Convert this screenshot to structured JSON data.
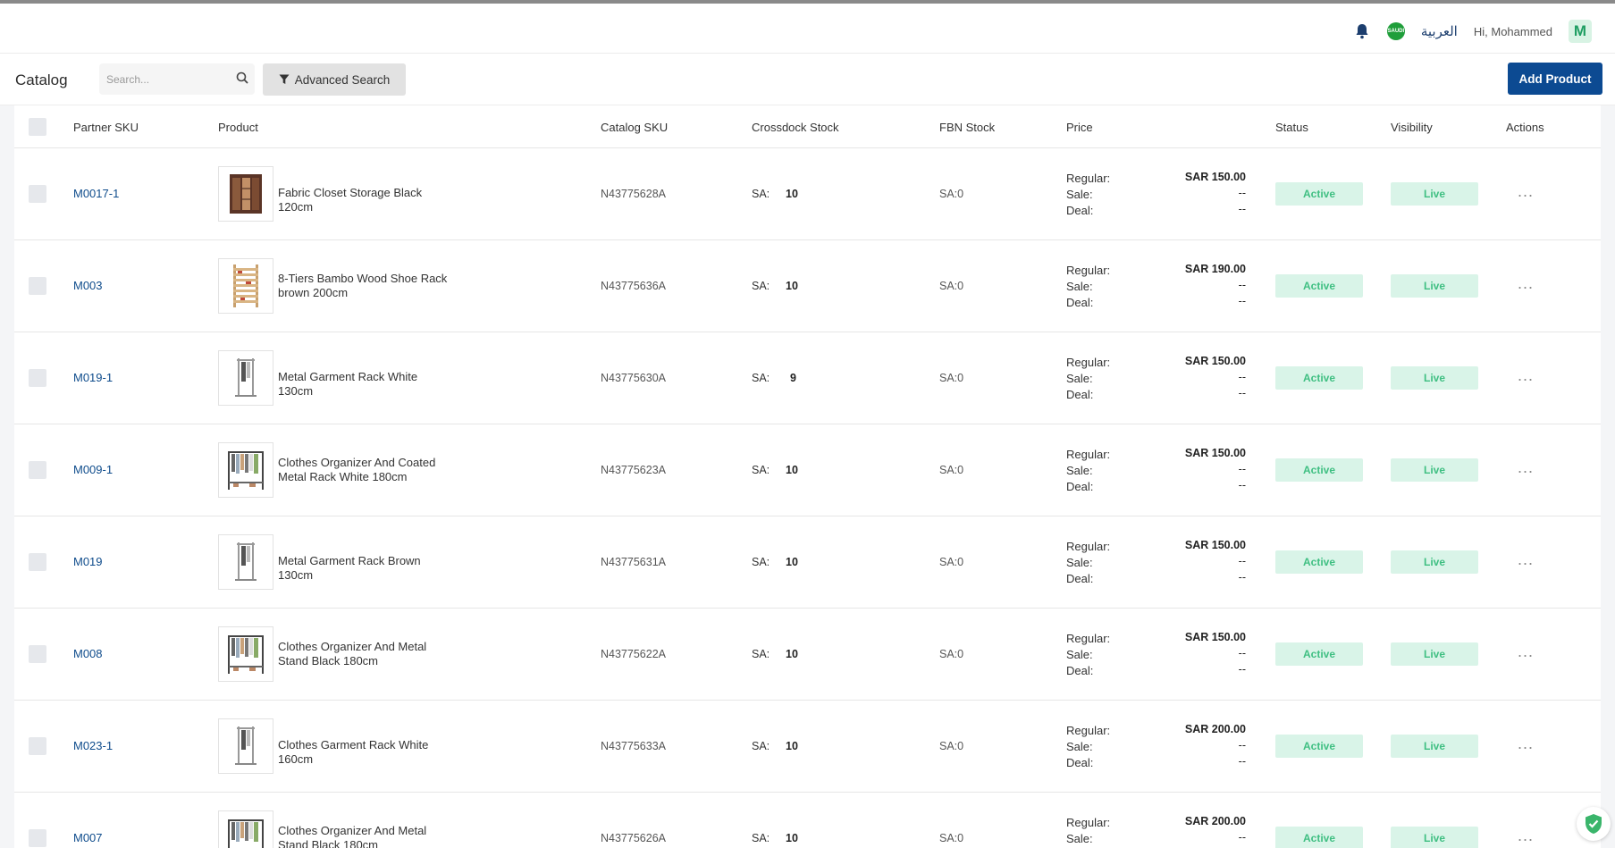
{
  "header": {
    "language": "العربية",
    "greeting": "Hi, Mohammed",
    "avatar_initial": "M",
    "flag_text": "SAUDI"
  },
  "toolbar": {
    "title": "Catalog",
    "search_placeholder": "Search...",
    "advanced_search": "Advanced Search",
    "add_product": "Add Product"
  },
  "columns": {
    "partner_sku": "Partner SKU",
    "product": "Product",
    "catalog_sku": "Catalog SKU",
    "crossdock": "Crossdock Stock",
    "fbn": "FBN Stock",
    "price": "Price",
    "status": "Status",
    "visibility": "Visibility",
    "actions": "Actions"
  },
  "labels": {
    "regular": "Regular:",
    "sale": "Sale:",
    "deal": "Deal:",
    "sa": "SA:",
    "dash": "--",
    "more": "..."
  },
  "rows": [
    {
      "sku": "M0017-1",
      "name": "Fabric Closet Storage Black 120cm",
      "catalog_sku": "N43775628A",
      "crossdock": "10",
      "fbn": "SA:0",
      "regular": "SAR 150.00",
      "status": "Active",
      "visibility": "Live",
      "thumb": "closet"
    },
    {
      "sku": "M003",
      "name": "8-Tiers Bambo Wood Shoe Rack brown 200cm",
      "catalog_sku": "N43775636A",
      "crossdock": "10",
      "fbn": "SA:0",
      "regular": "SAR 190.00",
      "status": "Active",
      "visibility": "Live",
      "thumb": "shelf"
    },
    {
      "sku": "M019-1",
      "name": "Metal Garment Rack White 130cm",
      "catalog_sku": "N43775630A",
      "crossdock": "9",
      "fbn": "SA:0",
      "regular": "SAR 150.00",
      "status": "Active",
      "visibility": "Live",
      "thumb": "rack"
    },
    {
      "sku": "M009-1",
      "name": "Clothes Organizer And Coated Metal Rack White 180cm",
      "catalog_sku": "N43775623A",
      "crossdock": "10",
      "fbn": "SA:0",
      "regular": "SAR 150.00",
      "status": "Active",
      "visibility": "Live",
      "thumb": "wide"
    },
    {
      "sku": "M019",
      "name": "Metal Garment Rack Brown 130cm",
      "catalog_sku": "N43775631A",
      "crossdock": "10",
      "fbn": "SA:0",
      "regular": "SAR 150.00",
      "status": "Active",
      "visibility": "Live",
      "thumb": "rack"
    },
    {
      "sku": "M008",
      "name": "Clothes Organizer And Metal Stand Black 180cm",
      "catalog_sku": "N43775622A",
      "crossdock": "10",
      "fbn": "SA:0",
      "regular": "SAR 150.00",
      "status": "Active",
      "visibility": "Live",
      "thumb": "wide"
    },
    {
      "sku": "M023-1",
      "name": "Clothes Garment Rack White 160cm",
      "catalog_sku": "N43775633A",
      "crossdock": "10",
      "fbn": "SA:0",
      "regular": "SAR 200.00",
      "status": "Active",
      "visibility": "Live",
      "thumb": "rack"
    },
    {
      "sku": "M007",
      "name": "Clothes Organizer And Metal Stand Black 180cm",
      "catalog_sku": "N43775626A",
      "crossdock": "10",
      "fbn": "SA:0",
      "regular": "SAR 200.00",
      "status": "Active",
      "visibility": "Live",
      "thumb": "wide"
    }
  ],
  "colors": {
    "brand": "#0c4a92",
    "sku_link": "#0f4c8c",
    "badge_bg": "#d9f4e8",
    "badge_text": "#3fbf82"
  }
}
